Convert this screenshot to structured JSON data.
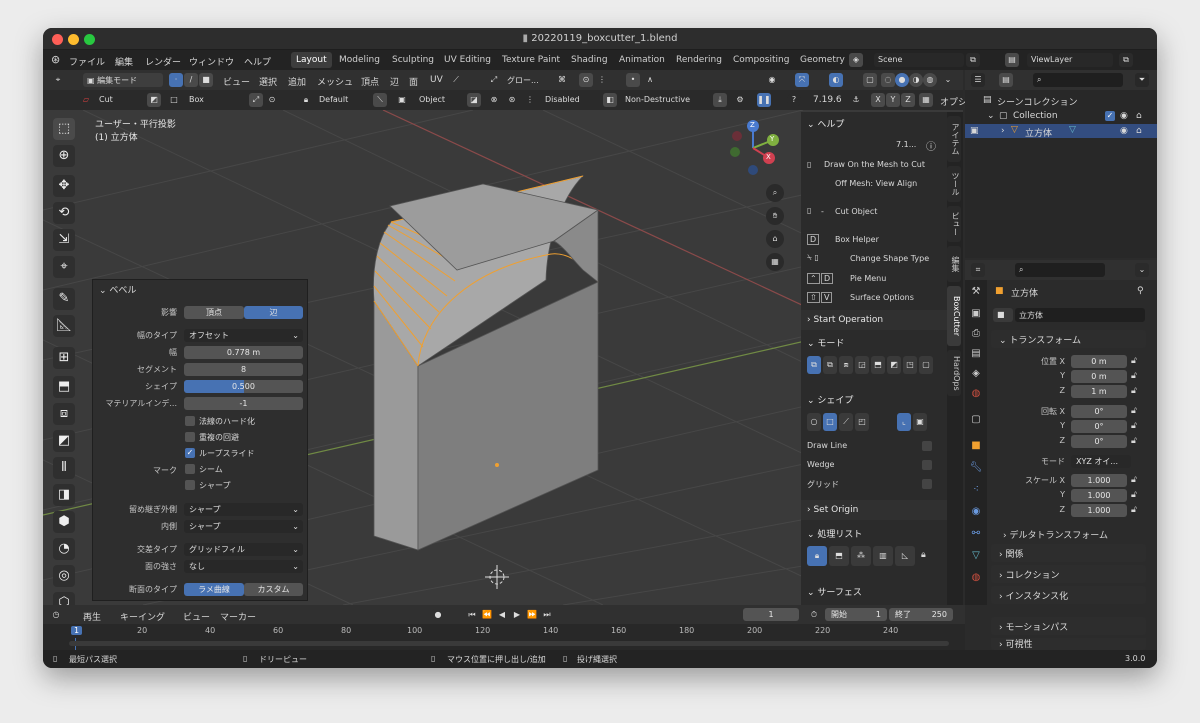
{
  "window": {
    "title": "20220119_boxcutter_1.blend"
  },
  "menus": [
    "ファイル",
    "編集",
    "レンダー",
    "ウィンドウ",
    "ヘルプ"
  ],
  "workspaces": [
    "Layout",
    "Modeling",
    "Sculpting",
    "UV Editing",
    "Texture Paint",
    "Shading",
    "Animation",
    "Rendering",
    "Compositing",
    "Geometry"
  ],
  "scene": "Scene",
  "view_layer": "ViewLayer",
  "viewport_header": {
    "mode": "編集モード",
    "menu": [
      "ビュー",
      "選択",
      "追加",
      "メッシュ",
      "頂点",
      "辺",
      "面",
      "UV"
    ],
    "orientation": "グロー...",
    "boxcutter_bar": {
      "tool": "Cut",
      "shape": "Box",
      "default": "Default",
      "object": "Object",
      "disabled": "Disabled",
      "mode": "Non-Destructive",
      "version": "7.19.6",
      "x": "X",
      "y": "Y",
      "z": "Z",
      "options": "オプシ"
    }
  },
  "viewport": {
    "line1": "ユーザー・平行投影",
    "line2": "(1) 立方体"
  },
  "gizmo_axes": {
    "x": "X",
    "y": "Y",
    "z": "Z"
  },
  "bevel": {
    "title": "ベベル",
    "affect_label": "影響",
    "affect_options": [
      "頂点",
      "辺"
    ],
    "affect_selected": "辺",
    "width_type_label": "幅のタイプ",
    "width_type": "オフセット",
    "width_label": "幅",
    "width": "0.778 m",
    "segments_label": "セグメント",
    "segments": "8",
    "shape_label": "シェイプ",
    "shape": "0.500",
    "shape_fraction": 0.5,
    "material_label": "マテリアルインデ...",
    "material": "-1",
    "harden_normals": "法線のハード化",
    "clamp_overlap": "重複の回避",
    "loop_slide": "ループスライド",
    "mark_label": "マーク",
    "seam": "シーム",
    "sharp": "シャープ",
    "miter_outer_label": "留め継ぎ外側",
    "miter_outer": "シャープ",
    "miter_inner_label": "内側",
    "miter_inner": "シャープ",
    "intersection_label": "交差タイプ",
    "intersection": "グリッドフィル",
    "face_strength_label": "面の強さ",
    "face_strength": "なし",
    "profile_label": "断面のタイプ",
    "profile_options": [
      "ラメ曲線",
      "カスタム"
    ]
  },
  "n_panel": {
    "help": "ヘルプ",
    "version": "7.1...",
    "draw_on_mesh": "Draw On the Mesh to Cut",
    "off_mesh": "Off Mesh: View Align",
    "hints": [
      {
        "key": "-",
        "text": "Cut Object"
      },
      {
        "key": "D",
        "text": "Box Helper"
      },
      {
        "key": "",
        "text": "Change Shape Type"
      },
      {
        "key": "D",
        "text": "Pie Menu"
      },
      {
        "key": "V",
        "text": "Surface Options"
      }
    ],
    "start_operation": "Start Operation",
    "mode_section": "モード",
    "shape_section": "シェイプ",
    "draw_line": "Draw Line",
    "wedge": "Wedge",
    "grid": "グリッド",
    "set_origin": "Set Origin",
    "process_list": "処理リスト",
    "surface": "サーフェス"
  },
  "n_tabs": [
    "アイテム",
    "ツール",
    "ビュー",
    "編集",
    "BoxCutter",
    "HardOps"
  ],
  "outliner": {
    "scene_collection": "シーンコレクション",
    "collection": "Collection",
    "object": "立方体"
  },
  "properties": {
    "object_name": "立方体",
    "mesh_name": "立方体",
    "transform": "トランスフォーム",
    "location_label": "位置 X",
    "location": [
      "0 m",
      "0 m",
      "1 m"
    ],
    "rotation_label": "回転 X",
    "rotation": [
      "0°",
      "0°",
      "0°"
    ],
    "mode_label": "モード",
    "mode": "XYZ オイ...",
    "scale_label": "スケール X",
    "scale": [
      "1.000",
      "1.000",
      "1.000"
    ],
    "axis_y": "Y",
    "axis_z": "Z",
    "delta": "デルタトランスフォーム",
    "sections": [
      "関係",
      "コレクション",
      "インスタンス化",
      "モーションパス",
      "可視性"
    ]
  },
  "timeline": {
    "menu": [
      "再生",
      "キーイング",
      "ビュー",
      "マーカー"
    ],
    "current_frame": "1",
    "start_label": "開始",
    "start": "1",
    "end_label": "終了",
    "end": "250",
    "ticks": [
      "1",
      "20",
      "40",
      "60",
      "80",
      "100",
      "120",
      "140",
      "160",
      "180",
      "200",
      "220",
      "240"
    ]
  },
  "statusbar": {
    "left": "最短パス選択",
    "mid": "ドリーピュー",
    "right1": "マウス位置に押し出し/追加",
    "right2": "投げ縄選択",
    "version": "3.0.0"
  },
  "colors": {
    "accent": "#4772b3",
    "selection": "#f0a030",
    "x_axis": "#d04050",
    "y_axis": "#80b040",
    "z_axis": "#4a7bd0"
  }
}
